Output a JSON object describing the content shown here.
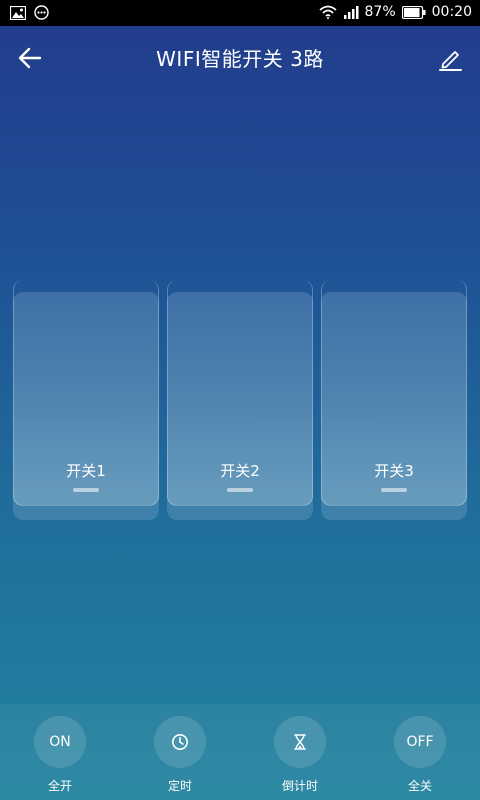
{
  "status_bar": {
    "battery": "87%",
    "time": "00:20"
  },
  "header": {
    "title": "WIFI智能开关 3路"
  },
  "switches": [
    {
      "label": "开关1"
    },
    {
      "label": "开关2"
    },
    {
      "label": "开关3"
    }
  ],
  "actions": {
    "all_on": {
      "icon_text": "ON",
      "label": "全开"
    },
    "timer": {
      "icon": "clock-icon",
      "label": "定时"
    },
    "countdown": {
      "icon": "hourglass-icon",
      "label": "倒计时"
    },
    "all_off": {
      "icon_text": "OFF",
      "label": "全关"
    }
  }
}
